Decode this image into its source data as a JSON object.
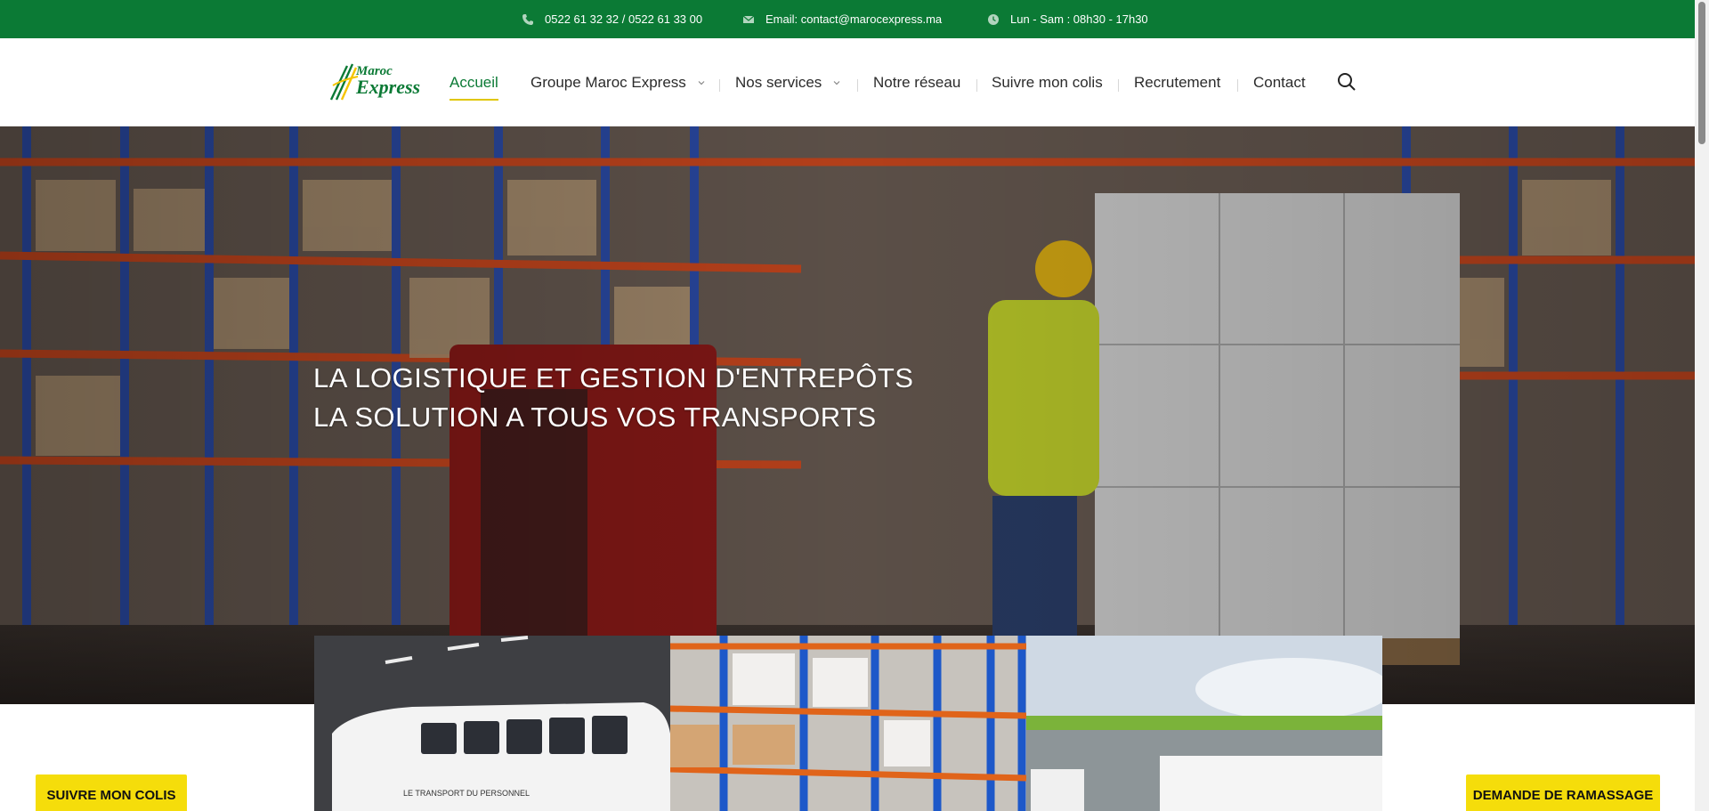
{
  "topbar": {
    "phone": "0522 61 32 32 / 0522 61 33 00",
    "email": "Email: contact@marocexpress.ma",
    "hours": "Lun - Sam : 08h30 - 17h30",
    "icons": [
      "phone-icon",
      "envelope-icon",
      "clock-icon"
    ]
  },
  "brand": {
    "line1": "Maroc",
    "line2": "Express",
    "colors": {
      "green": "#0b7a35",
      "yellow": "#f5dd0b"
    }
  },
  "nav": {
    "items": [
      {
        "label": "Accueil",
        "active": true
      },
      {
        "label": "Groupe Maroc Express",
        "dropdown": true
      },
      {
        "label": "Nos services",
        "dropdown": true
      },
      {
        "label": "Notre réseau"
      },
      {
        "label": "Suivre mon colis"
      },
      {
        "label": "Recrutement"
      },
      {
        "label": "Contact"
      }
    ]
  },
  "hero": {
    "line1": "LA LOGISTIQUE ET GESTION D'ENTREPÔTS",
    "line2": "LA SOLUTION A TOUS VOS TRANSPORTS"
  },
  "cta": {
    "left": "SUIVRE MON COLIS",
    "right": "DEMANDE DE RAMASSAGE"
  },
  "cards": {
    "card1_caption": "LE TRANSPORT DU PERSONNEL"
  }
}
